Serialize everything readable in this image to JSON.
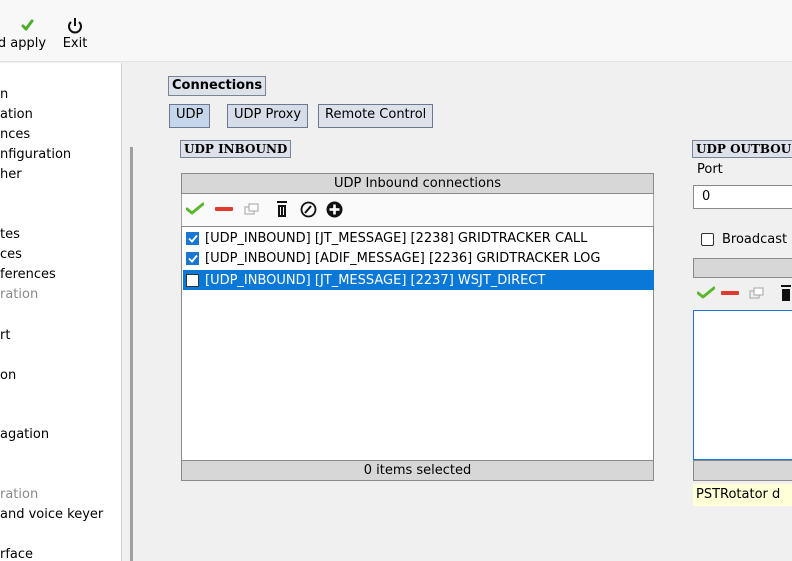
{
  "toolbar": {
    "apply_label": "d apply",
    "exit_label": "Exit"
  },
  "sidebar": {
    "items": [
      {
        "label": "n",
        "dim": false
      },
      {
        "label": "ation",
        "dim": false
      },
      {
        "label": "nces",
        "dim": false
      },
      {
        "label": "nfiguration",
        "dim": false
      },
      {
        "label": "her",
        "dim": false
      },
      {
        "label": "tes",
        "dim": false
      },
      {
        "label": "ces",
        "dim": false
      },
      {
        "label": "ferences",
        "dim": false
      },
      {
        "label": "ration",
        "dim": true
      },
      {
        "label": "rt",
        "dim": false
      },
      {
        "label": "on",
        "dim": false
      },
      {
        "label": "agation",
        "dim": false
      },
      {
        "label": "ration",
        "dim": true
      },
      {
        "label": "and voice keyer",
        "dim": false
      },
      {
        "label": "rface",
        "dim": false
      }
    ]
  },
  "main": {
    "section_title": "Connections",
    "tabs": [
      {
        "label": "UDP",
        "active": true
      },
      {
        "label": "UDP Proxy",
        "active": false
      },
      {
        "label": "Remote Control",
        "active": false
      }
    ],
    "inbound": {
      "title": "UDP INBOUND",
      "list_header": "UDP Inbound connections",
      "rows": [
        {
          "checked": true,
          "text": "[UDP_INBOUND] [JT_MESSAGE] [2238] GRIDTRACKER CALL",
          "selected": false
        },
        {
          "checked": true,
          "text": "[UDP_INBOUND] [ADIF_MESSAGE] [2236] GRIDTRACKER LOG",
          "selected": false
        },
        {
          "checked": false,
          "text": "[UDP_INBOUND] [JT_MESSAGE] [2237] WSJT_DIRECT",
          "selected": true
        }
      ],
      "footer": "0 items selected"
    },
    "outbound": {
      "title": "UDP OUTBOU",
      "port_label": "Port",
      "port_value": "0",
      "broadcast_label": "Broadcast",
      "status_text": "PSTRotator d"
    }
  },
  "colors": {
    "selection": "#0a78d7",
    "check_blue": "#1976d2",
    "accept_green": "#5ab82c",
    "remove_red": "#e03a2e"
  }
}
